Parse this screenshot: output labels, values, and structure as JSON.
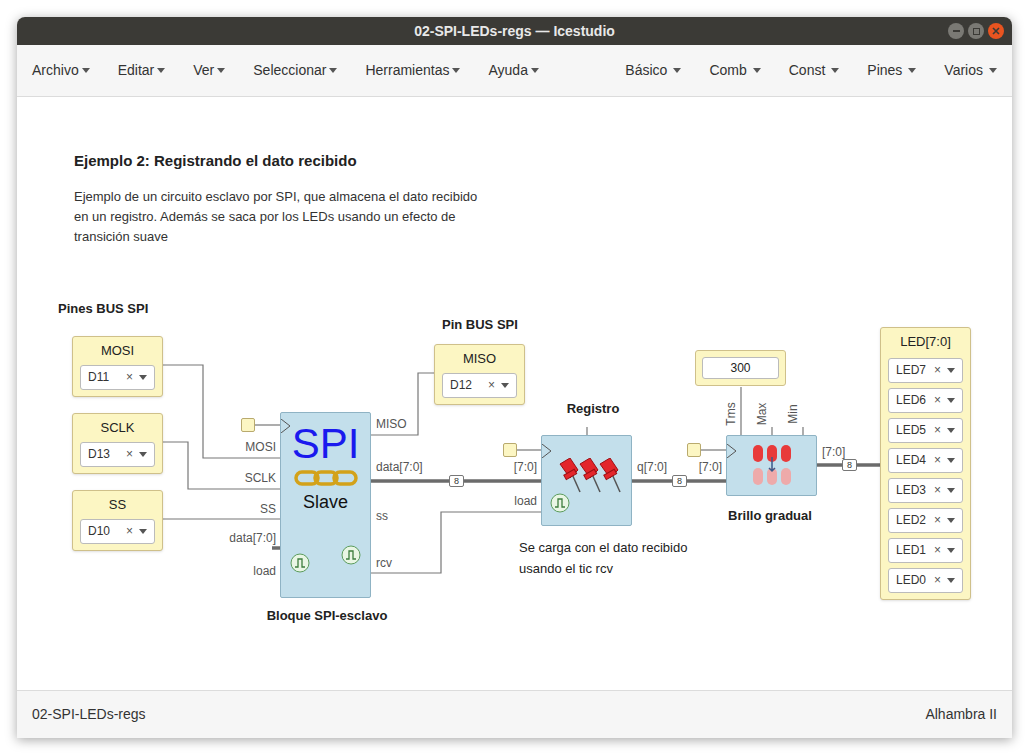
{
  "window": {
    "title": "02-SPI-LEDs-regs — Icestudio"
  },
  "menu": {
    "left": [
      "Archivo",
      "Editar",
      "Ver",
      "Seleccionar",
      "Herramientas",
      "Ayuda"
    ],
    "right": [
      "Básico",
      "Comb",
      "Const",
      "Pines",
      "Varios"
    ]
  },
  "diagram": {
    "heading": "Ejemplo 2: Registrando el dato recibido",
    "description": [
      "Ejemplo de un circuito esclavo por SPI, que almacena el dato recibido",
      "en un registro. Además se saca por los LEDs usando un efecto de",
      "transición suave"
    ],
    "spi_pins_label": "Pines BUS SPI",
    "miso_pin_label": "Pin BUS SPI",
    "clear_glyph": "×",
    "input_pins": [
      {
        "name": "MOSI",
        "pin": "D11"
      },
      {
        "name": "SCLK",
        "pin": "D13"
      },
      {
        "name": "SS",
        "pin": "D10"
      }
    ],
    "output_pin": {
      "name": "MISO",
      "pin": "D12"
    },
    "spi_block": {
      "title": "SPI",
      "subtitle": "Slave",
      "caption": "Bloque SPI-esclavo",
      "inputs": [
        "MOSI",
        "SCLK",
        "SS",
        "data[7:0]",
        "load"
      ],
      "outputs": [
        "MISO",
        "data[7:0]",
        "ss",
        "rcv"
      ]
    },
    "register": {
      "title": "Registro",
      "inputs": [
        "[7:0]",
        "load"
      ],
      "output": "q[7:0]",
      "note": [
        "Se carga con el dato recibido",
        "usando el tic rcv"
      ]
    },
    "constant": {
      "value": "300"
    },
    "fader": {
      "caption": "Brillo gradual",
      "params": [
        "Tms",
        "Max",
        "Min"
      ],
      "input": "[7:0]",
      "output": "[7:0]"
    },
    "bus_badges": [
      "8",
      "8",
      "8"
    ],
    "leds": {
      "label": "LED[7:0]",
      "pins": [
        "LED7",
        "LED6",
        "LED5",
        "LED4",
        "LED3",
        "LED2",
        "LED1",
        "LED0"
      ]
    }
  },
  "status_bar": {
    "left": "02-SPI-LEDs-regs",
    "right": "Alhambra II"
  }
}
